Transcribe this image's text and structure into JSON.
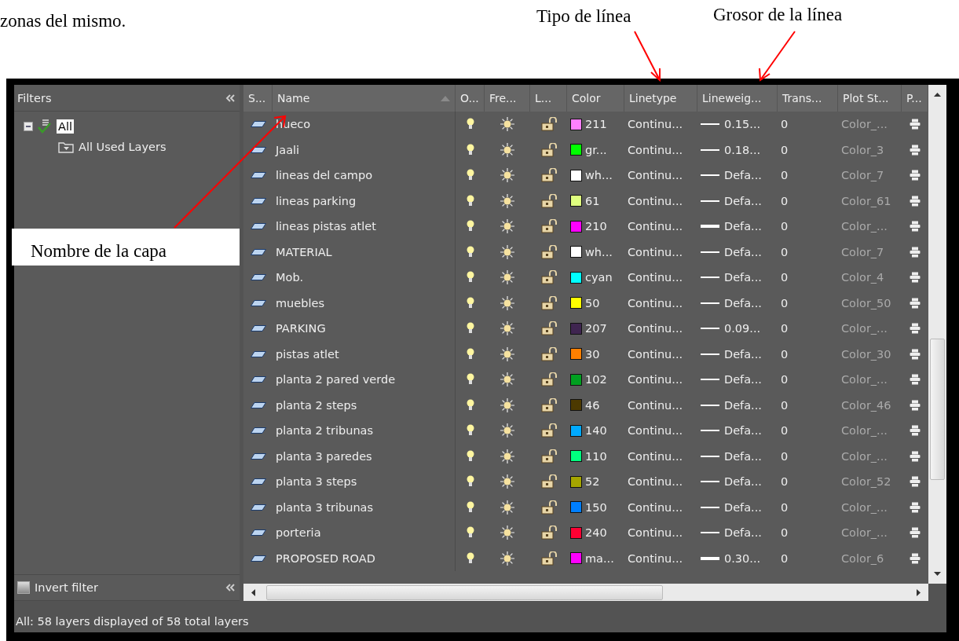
{
  "document": {
    "text": "zonas del mismo."
  },
  "annotations": [
    {
      "text": "Tipo de línea",
      "kind": "plain"
    },
    {
      "text": "Grosor de la línea",
      "kind": "plain"
    },
    {
      "text": "Nombre de la capa",
      "kind": "boxed"
    }
  ],
  "filters": {
    "title": "Filters",
    "tree": [
      {
        "label": "All",
        "selected": true,
        "expanded": true,
        "children": [
          {
            "label": "All Used Layers",
            "selected": false
          }
        ]
      }
    ],
    "invert_filter": {
      "label": "Invert filter",
      "checked": false
    }
  },
  "columns": [
    "S...",
    "Name",
    "O...",
    "Fre...",
    "L...",
    "Color",
    "Linetype",
    "Lineweig...",
    "Trans...",
    "Plot St...",
    "P..."
  ],
  "layers": [
    {
      "name": "hueco",
      "on": true,
      "frozen": false,
      "locked": false,
      "color": "#ff80ff",
      "color_label": "211",
      "linetype": "Continu...",
      "lineweight": "0.15...",
      "heavy": false,
      "transparency": "0",
      "plot_style": "Color_..."
    },
    {
      "name": "Jaali",
      "on": true,
      "frozen": false,
      "locked": false,
      "color": "#00ff00",
      "color_label": "gr...",
      "linetype": "Continu...",
      "lineweight": "0.18...",
      "heavy": false,
      "transparency": "0",
      "plot_style": "Color_3"
    },
    {
      "name": "lineas del campo",
      "on": true,
      "frozen": false,
      "locked": false,
      "color": "#ffffff",
      "color_label": "wh...",
      "linetype": "Continu...",
      "lineweight": "Defa...",
      "heavy": false,
      "transparency": "0",
      "plot_style": "Color_7"
    },
    {
      "name": "lineas parking",
      "on": true,
      "frozen": false,
      "locked": false,
      "color": "#dfff7f",
      "color_label": "61",
      "linetype": "Continu...",
      "lineweight": "Defa...",
      "heavy": false,
      "transparency": "0",
      "plot_style": "Color_61"
    },
    {
      "name": "lineas pistas atlet",
      "on": true,
      "frozen": false,
      "locked": false,
      "color": "#ff00ff",
      "color_label": "210",
      "linetype": "Continu...",
      "lineweight": "Defa...",
      "heavy": true,
      "transparency": "0",
      "plot_style": "Color_..."
    },
    {
      "name": "MATERIAL",
      "on": true,
      "frozen": false,
      "locked": false,
      "color": "#ffffff",
      "color_label": "wh...",
      "linetype": "Continu...",
      "lineweight": "Defa...",
      "heavy": false,
      "transparency": "0",
      "plot_style": "Color_7"
    },
    {
      "name": "Mob.",
      "on": true,
      "frozen": false,
      "locked": false,
      "color": "#00ffff",
      "color_label": "cyan",
      "linetype": "Continu...",
      "lineweight": "Defa...",
      "heavy": false,
      "transparency": "0",
      "plot_style": "Color_4"
    },
    {
      "name": "muebles",
      "on": true,
      "frozen": false,
      "locked": false,
      "color": "#ffff00",
      "color_label": "50",
      "linetype": "Continu...",
      "lineweight": "Defa...",
      "heavy": false,
      "transparency": "0",
      "plot_style": "Color_50"
    },
    {
      "name": "PARKING",
      "on": true,
      "frozen": false,
      "locked": false,
      "color": "#3f2550",
      "color_label": "207",
      "linetype": "Continu...",
      "lineweight": "0.09...",
      "heavy": false,
      "transparency": "0",
      "plot_style": "Color_..."
    },
    {
      "name": "pistas atlet",
      "on": true,
      "frozen": false,
      "locked": false,
      "color": "#ff7f00",
      "color_label": "30",
      "linetype": "Continu...",
      "lineweight": "Defa...",
      "heavy": false,
      "transparency": "0",
      "plot_style": "Color_30"
    },
    {
      "name": "planta 2 pared verde",
      "on": true,
      "frozen": false,
      "locked": false,
      "color": "#00a020",
      "color_label": "102",
      "linetype": "Continu...",
      "lineweight": "Defa...",
      "heavy": false,
      "transparency": "0",
      "plot_style": "Color_..."
    },
    {
      "name": "planta 2 steps",
      "on": true,
      "frozen": false,
      "locked": false,
      "color": "#4c3900",
      "color_label": "46",
      "linetype": "Continu...",
      "lineweight": "Defa...",
      "heavy": false,
      "transparency": "0",
      "plot_style": "Color_46"
    },
    {
      "name": "planta 2 tribunas",
      "on": true,
      "frozen": false,
      "locked": false,
      "color": "#00aaff",
      "color_label": "140",
      "linetype": "Continu...",
      "lineweight": "Defa...",
      "heavy": false,
      "transparency": "0",
      "plot_style": "Color_..."
    },
    {
      "name": "planta 3 paredes",
      "on": true,
      "frozen": false,
      "locked": false,
      "color": "#00ff7f",
      "color_label": "110",
      "linetype": "Continu...",
      "lineweight": "Defa...",
      "heavy": false,
      "transparency": "0",
      "plot_style": "Color_..."
    },
    {
      "name": "planta 3 steps",
      "on": true,
      "frozen": false,
      "locked": false,
      "color": "#a5a500",
      "color_label": "52",
      "linetype": "Continu...",
      "lineweight": "Defa...",
      "heavy": false,
      "transparency": "0",
      "plot_style": "Color_52"
    },
    {
      "name": "planta 3 tribunas",
      "on": true,
      "frozen": false,
      "locked": false,
      "color": "#007fff",
      "color_label": "150",
      "linetype": "Continu...",
      "lineweight": "Defa...",
      "heavy": false,
      "transparency": "0",
      "plot_style": "Color_..."
    },
    {
      "name": "porteria",
      "on": true,
      "frozen": false,
      "locked": false,
      "color": "#ff0033",
      "color_label": "240",
      "linetype": "Continu...",
      "lineweight": "Defa...",
      "heavy": false,
      "transparency": "0",
      "plot_style": "Color_..."
    },
    {
      "name": "PROPOSED ROAD",
      "on": true,
      "frozen": false,
      "locked": false,
      "color": "#ff00ff",
      "color_label": "ma...",
      "linetype": "Continu...",
      "lineweight": "0.30...",
      "heavy": true,
      "transparency": "0",
      "plot_style": "Color_6"
    }
  ],
  "status_bar": "All: 58 layers displayed of 58 total layers"
}
